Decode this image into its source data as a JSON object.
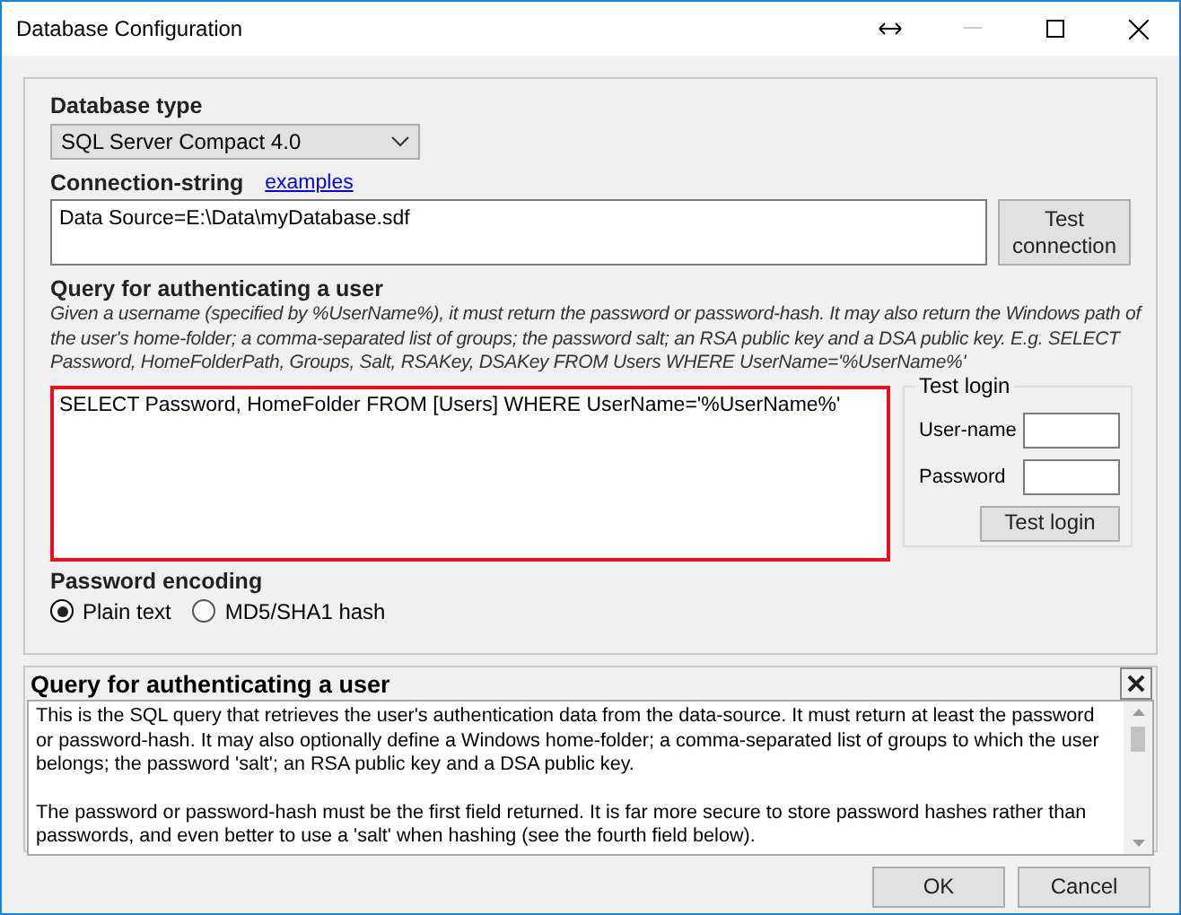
{
  "window": {
    "title": "Database Configuration"
  },
  "database_type": {
    "label": "Database type",
    "value": "SQL Server Compact 4.0"
  },
  "connection": {
    "label": "Connection-string",
    "link": "examples",
    "value": "Data Source=E:\\Data\\myDatabase.sdf",
    "test_button": "Test\nconnection"
  },
  "query": {
    "label": "Query for authenticating a user",
    "description": "Given a username (specified by %UserName%), it must return the password or password-hash.  It may also return the Windows path of the user's home-folder; a comma-separated list of groups; the password salt; an RSA public key and a DSA public key. E.g. SELECT Password, HomeFolderPath, Groups, Salt, RSAKey, DSAKey FROM Users WHERE UserName='%UserName%'",
    "value": "SELECT Password, HomeFolder FROM [Users] WHERE UserName='%UserName%'"
  },
  "test_login": {
    "title": "Test login",
    "fields": [
      {
        "label": "User-name"
      },
      {
        "label": "Password"
      }
    ],
    "button": "Test login"
  },
  "password_encoding": {
    "label": "Password encoding",
    "options": [
      {
        "label": "Plain text",
        "selected": true
      },
      {
        "label": "MD5/SHA1 hash",
        "selected": false
      }
    ]
  },
  "help": {
    "title": "Query for authenticating a user",
    "paragraphs": [
      "This is the SQL query that retrieves the user's authentication data from the data-source.  It must return at least the password or password-hash. It may also optionally define a Windows home-folder; a comma-separated list of groups to which the user belongs; the password 'salt'; an RSA public key and a DSA public key.",
      "The password or password-hash must be the first field returned. It is far more secure to store password hashes rather than passwords, and even better to use a 'salt' when hashing (see the fourth field below)."
    ]
  },
  "buttons": [
    "OK",
    "Cancel"
  ]
}
